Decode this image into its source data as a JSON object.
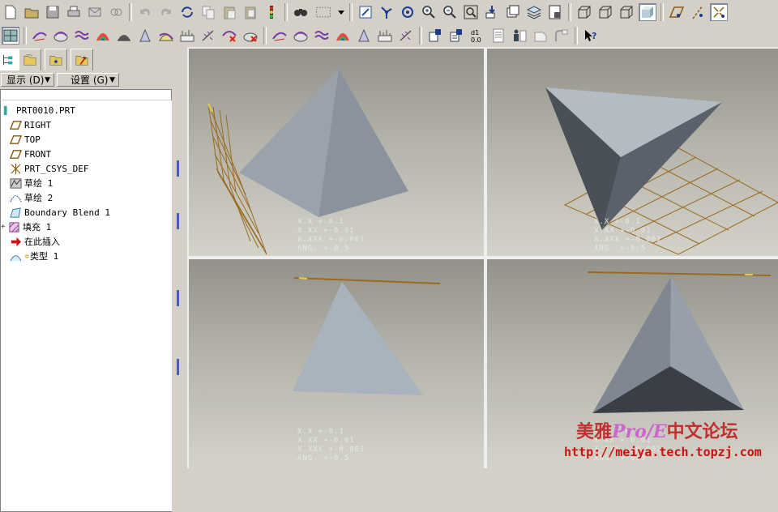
{
  "toolbar_top": {
    "icons": [
      "new-icon",
      "open-icon",
      "save-icon",
      "print-icon",
      "send-mail-icon",
      "send-link-icon",
      "undo-icon",
      "redo-icon",
      "regenerate-icon",
      "copy-icon",
      "paste-icon",
      "paste-special-icon",
      "model-player-icon",
      "find-icon",
      "select-box-icon",
      "select-dropdown-icon",
      "repaint-icon",
      "spin-center-icon",
      "orient-icon",
      "zoom-in-icon",
      "zoom-out-icon",
      "refit-icon",
      "reorient-icon",
      "saved-views-icon",
      "layers-icon",
      "view-manager-icon",
      "wireframe-icon",
      "hidden-line-icon",
      "no-hidden-icon",
      "shading-icon",
      "datum-planes-icon",
      "datum-axes-icon",
      "datum-points-icon"
    ],
    "colors": {
      "accent": "#1a3c8c"
    }
  },
  "toolbar_second": {
    "icons": [
      "dual-view-icon",
      "curvature-icon",
      "section-icon",
      "reflection-icon",
      "shade-analysis-icon",
      "draft-icon",
      "slope-icon",
      "offset-icon",
      "dihedral-icon",
      "deviation-icon",
      "delete-analysis-icon",
      "curvature2-icon",
      "section2-icon",
      "reflection2-icon",
      "shade2-icon",
      "draft2-icon",
      "offset2-icon",
      "deviation2-icon",
      "sketch-orient-icon",
      "sketch-ref-icon",
      "dim-icon",
      "relations-icon",
      "family-table-icon",
      "program-icon",
      "feature-info-icon",
      "whats-this-icon"
    ]
  },
  "panel": {
    "menu_display": "显示 (D)",
    "menu_settings": "设置 (G)",
    "tree": [
      {
        "label": "PRT0010.PRT",
        "icon": "part-icon"
      },
      {
        "label": "RIGHT",
        "icon": "datum-plane-icon"
      },
      {
        "label": "TOP",
        "icon": "datum-plane-icon"
      },
      {
        "label": "FRONT",
        "icon": "datum-plane-icon"
      },
      {
        "label": "PRT_CSYS_DEF",
        "icon": "csys-icon"
      },
      {
        "label": "草绘 1",
        "icon": "sketch-icon"
      },
      {
        "label": "草绘 2",
        "icon": "sketch-icon"
      },
      {
        "label": "Boundary Blend 1",
        "icon": "boundary-blend-icon"
      },
      {
        "label": "填充 1",
        "icon": "fill-icon"
      },
      {
        "label": "在此插入",
        "icon": "insert-here-icon"
      },
      {
        "label": "类型 1",
        "icon": "type-icon"
      }
    ]
  },
  "tolerance": {
    "line1": "X.X   +-0.1",
    "line2": "X.XX  +-0.01",
    "line3": "X.XXX +-0.001",
    "line4": "ANG.  +-0.5"
  },
  "watermark": {
    "title_a": "美雅",
    "title_b": "Pro/E",
    "title_c": "中文论坛",
    "url": "http://meiya.tech.topzj.com"
  }
}
